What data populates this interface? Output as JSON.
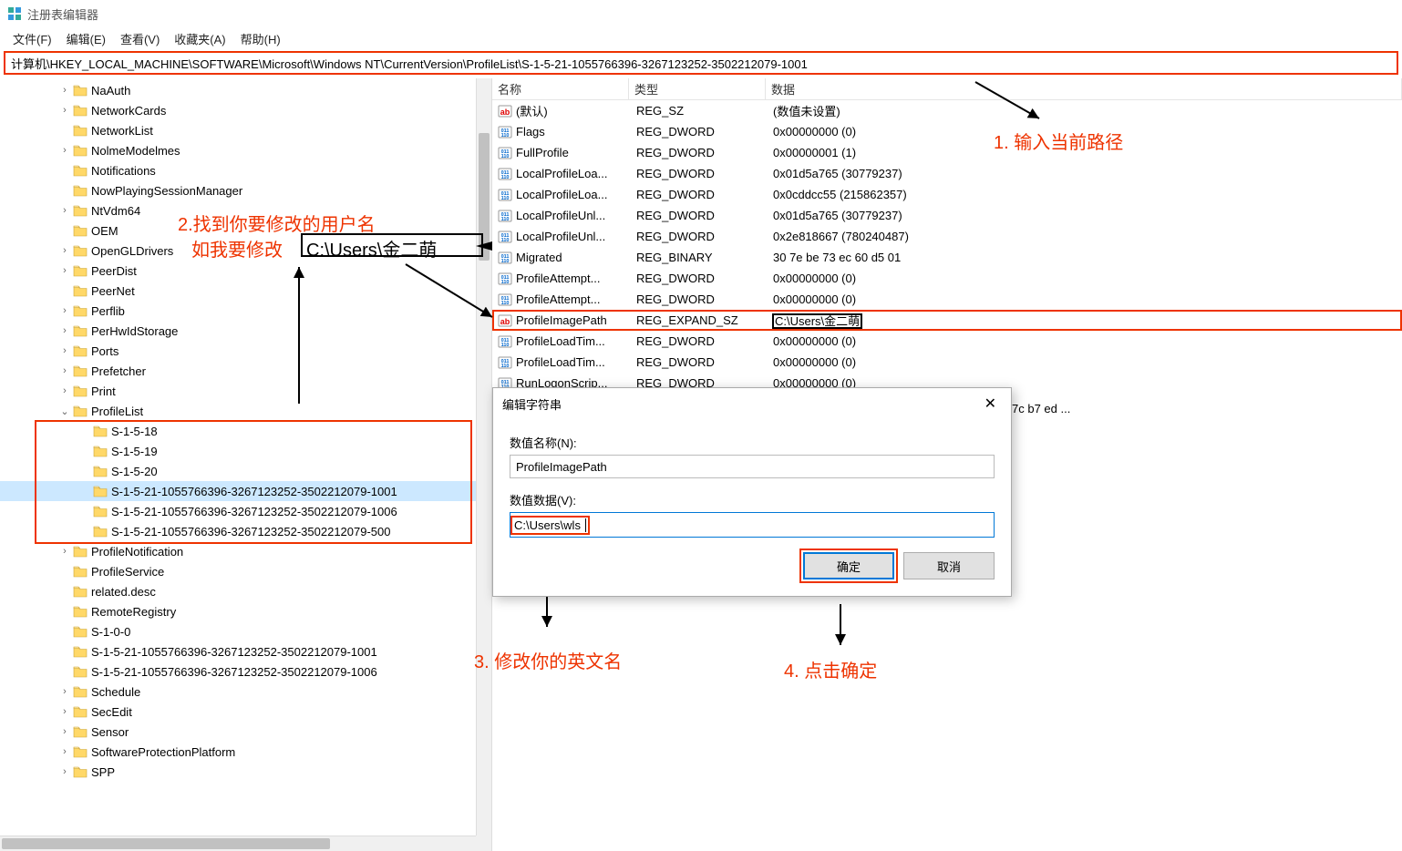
{
  "window": {
    "title": "注册表编辑器"
  },
  "menu": {
    "file": "文件(F)",
    "edit": "编辑(E)",
    "view": "查看(V)",
    "fav": "收藏夹(A)",
    "help": "帮助(H)"
  },
  "address": "计算机\\HKEY_LOCAL_MACHINE\\SOFTWARE\\Microsoft\\Windows NT\\CurrentVersion\\ProfileList\\S-1-5-21-1055766396-3267123252-3502212079-1001",
  "tree": {
    "items": [
      {
        "depth": 2,
        "exp": ">",
        "label": "NaAuth"
      },
      {
        "depth": 2,
        "exp": ">",
        "label": "NetworkCards"
      },
      {
        "depth": 2,
        "exp": "",
        "label": "NetworkList"
      },
      {
        "depth": 2,
        "exp": ">",
        "label": "NolmeModelmes"
      },
      {
        "depth": 2,
        "exp": "",
        "label": "Notifications"
      },
      {
        "depth": 2,
        "exp": "",
        "label": "NowPlayingSessionManager"
      },
      {
        "depth": 2,
        "exp": ">",
        "label": "NtVdm64"
      },
      {
        "depth": 2,
        "exp": "",
        "label": "OEM"
      },
      {
        "depth": 2,
        "exp": ">",
        "label": "OpenGLDrivers"
      },
      {
        "depth": 2,
        "exp": ">",
        "label": "PeerDist"
      },
      {
        "depth": 2,
        "exp": "",
        "label": "PeerNet"
      },
      {
        "depth": 2,
        "exp": ">",
        "label": "Perflib"
      },
      {
        "depth": 2,
        "exp": ">",
        "label": "PerHwIdStorage"
      },
      {
        "depth": 2,
        "exp": ">",
        "label": "Ports"
      },
      {
        "depth": 2,
        "exp": ">",
        "label": "Prefetcher"
      },
      {
        "depth": 2,
        "exp": ">",
        "label": "Print"
      },
      {
        "depth": 2,
        "exp": "v",
        "label": "ProfileList"
      },
      {
        "depth": 3,
        "exp": "",
        "label": "S-1-5-18"
      },
      {
        "depth": 3,
        "exp": "",
        "label": "S-1-5-19"
      },
      {
        "depth": 3,
        "exp": "",
        "label": "S-1-5-20"
      },
      {
        "depth": 3,
        "exp": "",
        "label": "S-1-5-21-1055766396-3267123252-3502212079-1001",
        "sel": true
      },
      {
        "depth": 3,
        "exp": "",
        "label": "S-1-5-21-1055766396-3267123252-3502212079-1006"
      },
      {
        "depth": 3,
        "exp": "",
        "label": "S-1-5-21-1055766396-3267123252-3502212079-500"
      },
      {
        "depth": 2,
        "exp": ">",
        "label": "ProfileNotification"
      },
      {
        "depth": 2,
        "exp": "",
        "label": "ProfileService"
      },
      {
        "depth": 2,
        "exp": "",
        "label": "related.desc"
      },
      {
        "depth": 2,
        "exp": "",
        "label": "RemoteRegistry"
      },
      {
        "depth": 2,
        "exp": "",
        "label": "S-1-0-0"
      },
      {
        "depth": 2,
        "exp": "",
        "label": "S-1-5-21-1055766396-3267123252-3502212079-1001"
      },
      {
        "depth": 2,
        "exp": "",
        "label": "S-1-5-21-1055766396-3267123252-3502212079-1006"
      },
      {
        "depth": 2,
        "exp": ">",
        "label": "Schedule"
      },
      {
        "depth": 2,
        "exp": ">",
        "label": "SecEdit"
      },
      {
        "depth": 2,
        "exp": ">",
        "label": "Sensor"
      },
      {
        "depth": 2,
        "exp": ">",
        "label": "SoftwareProtectionPlatform"
      },
      {
        "depth": 2,
        "exp": ">",
        "label": "SPP"
      }
    ]
  },
  "values": {
    "headers": {
      "name": "名称",
      "type": "类型",
      "data": "数据"
    },
    "rows": [
      {
        "icon": "str",
        "name": "(默认)",
        "type": "REG_SZ",
        "data": "(数值未设置)"
      },
      {
        "icon": "bin",
        "name": "Flags",
        "type": "REG_DWORD",
        "data": "0x00000000 (0)"
      },
      {
        "icon": "bin",
        "name": "FullProfile",
        "type": "REG_DWORD",
        "data": "0x00000001 (1)"
      },
      {
        "icon": "bin",
        "name": "LocalProfileLoa...",
        "type": "REG_DWORD",
        "data": "0x01d5a765 (30779237)"
      },
      {
        "icon": "bin",
        "name": "LocalProfileLoa...",
        "type": "REG_DWORD",
        "data": "0x0cddcc55 (215862357)"
      },
      {
        "icon": "bin",
        "name": "LocalProfileUnl...",
        "type": "REG_DWORD",
        "data": "0x01d5a765 (30779237)"
      },
      {
        "icon": "bin",
        "name": "LocalProfileUnl...",
        "type": "REG_DWORD",
        "data": "0x2e818667 (780240487)"
      },
      {
        "icon": "bin",
        "name": "Migrated",
        "type": "REG_BINARY",
        "data": "30 7e be 73 ec 60 d5 01"
      },
      {
        "icon": "bin",
        "name": "ProfileAttempt...",
        "type": "REG_DWORD",
        "data": "0x00000000 (0)"
      },
      {
        "icon": "bin",
        "name": "ProfileAttempt...",
        "type": "REG_DWORD",
        "data": "0x00000000 (0)"
      },
      {
        "icon": "str",
        "name": "ProfileImagePath",
        "type": "REG_EXPAND_SZ",
        "data": "C:\\Users\\金二萌",
        "hl": true
      },
      {
        "icon": "bin",
        "name": "ProfileLoadTim...",
        "type": "REG_DWORD",
        "data": "0x00000000 (0)"
      },
      {
        "icon": "bin",
        "name": "ProfileLoadTim...",
        "type": "REG_DWORD",
        "data": "0x00000000 (0)"
      },
      {
        "icon": "bin",
        "name": "RunLogonScrip...",
        "type": "REG_DWORD",
        "data": "0x00000000 (0)"
      }
    ],
    "extra_data_tail": "7c b7 ed ..."
  },
  "dialog": {
    "title": "编辑字符串",
    "name_label": "数值名称(N):",
    "name_value": "ProfileImagePath",
    "data_label": "数值数据(V):",
    "data_value": "C:\\Users\\wls",
    "ok": "确定",
    "cancel": "取消"
  },
  "annotations": {
    "a1": "1. 输入当前路径",
    "a2a": "2.找到你要修改的用户名",
    "a2b": "如我要修改",
    "a2c": "C:\\Users\\金二萌",
    "a3": "3. 修改你的英文名",
    "a4": "4. 点击确定"
  }
}
